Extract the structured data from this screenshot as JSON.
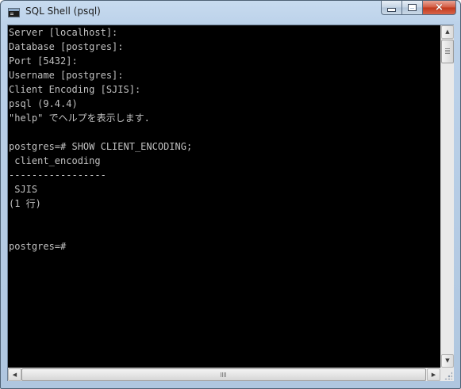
{
  "window": {
    "title": "SQL Shell (psql)",
    "icon": "console-icon",
    "buttons": {
      "minimize": "minimize-icon",
      "maximize": "maximize-icon",
      "close": "×"
    }
  },
  "console": {
    "lines": [
      "Server [localhost]:",
      "Database [postgres]:",
      "Port [5432]:",
      "Username [postgres]:",
      "Client Encoding [SJIS]:",
      "psql (9.4.4)",
      "\"help\" でヘルプを表示します.",
      "",
      "postgres=# SHOW CLIENT_ENCODING;",
      " client_encoding",
      "-----------------",
      " SJIS",
      "(1 行)",
      "",
      "",
      "postgres=#"
    ]
  },
  "scrollbars": {
    "vertical": {
      "up": "▲",
      "down": "▼"
    },
    "horizontal": {
      "left": "◀",
      "right": "▶"
    }
  },
  "colors": {
    "console_bg": "#000000",
    "console_fg": "#c0c0c0",
    "close_button": "#c2391c",
    "window_frame": "#bcd2ea"
  }
}
